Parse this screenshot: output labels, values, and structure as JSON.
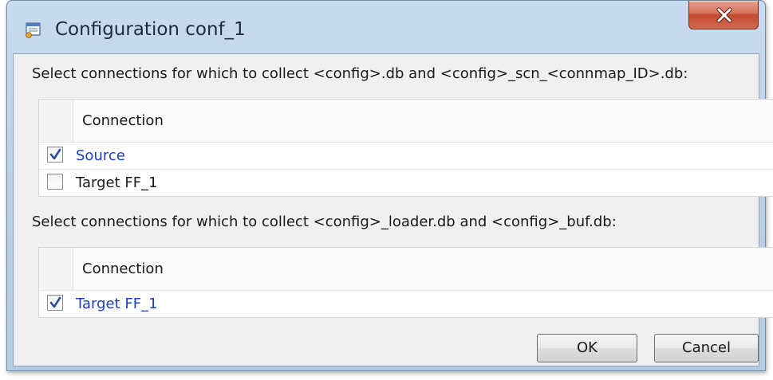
{
  "window": {
    "title": "Configuration conf_1",
    "icon": "config-window-icon",
    "close_icon": "close-icon",
    "close_color": "#c8472e"
  },
  "section1": {
    "instruction": "Select connections for which to collect <config>.db and <config>_scn_<connmap_ID>.db:",
    "column_header": "Connection",
    "rows": [
      {
        "label": "Source",
        "checked": true
      },
      {
        "label": "Target FF_1",
        "checked": false
      }
    ]
  },
  "section2": {
    "instruction": "Select connections for which to collect <config>_loader.db and <config>_buf.db:",
    "column_header": "Connection",
    "rows": [
      {
        "label": "Target FF_1",
        "checked": true
      }
    ]
  },
  "buttons": {
    "ok": "OK",
    "cancel": "Cancel"
  },
  "colors": {
    "link_text": "#1a3fc4",
    "checkmark": "#2b4f9a"
  }
}
